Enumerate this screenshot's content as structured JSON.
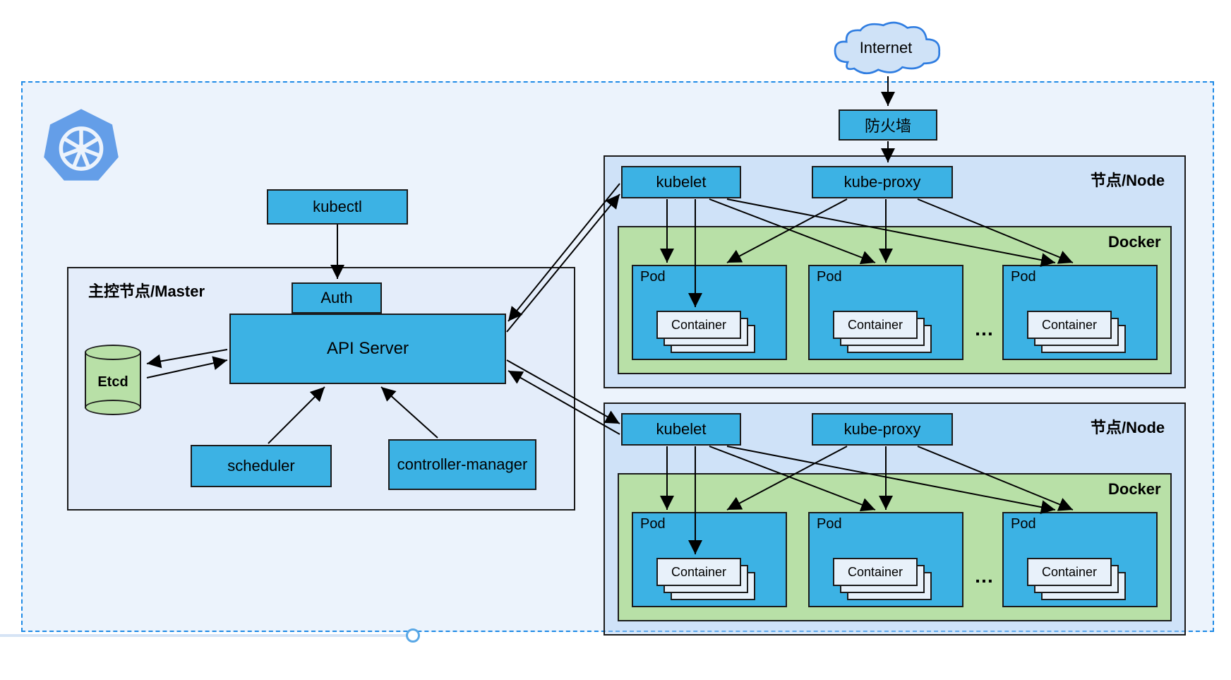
{
  "internet": {
    "label": "Internet"
  },
  "firewall": {
    "label": "防火墙"
  },
  "kubectl": {
    "label": "kubectl"
  },
  "master": {
    "title": "主控节点/Master",
    "auth": "Auth",
    "apiServer": "API Server",
    "scheduler": "scheduler",
    "controllerManager": "controller-manager",
    "etcd": "Etcd"
  },
  "node": {
    "title": "节点/Node",
    "kubelet": "kubelet",
    "kubeProxy": "kube-proxy",
    "docker": "Docker",
    "pod": "Pod",
    "container": "Container",
    "ellipsis": "…"
  },
  "colors": {
    "accentBlue": "#3cb2e4",
    "borderBlue": "#1e8ae6",
    "green": "#b8e0a7",
    "black": "#1b1b1b"
  }
}
